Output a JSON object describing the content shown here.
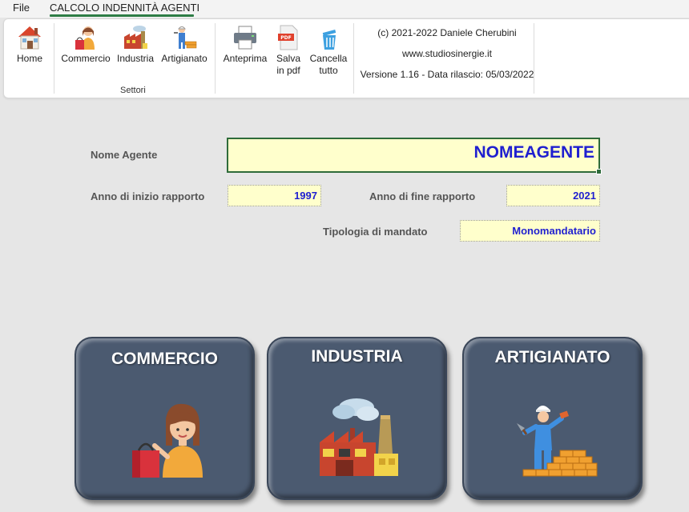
{
  "menu": {
    "file": "File",
    "active_tab": "CALCOLO INDENNITÀ AGENTI"
  },
  "ribbon": {
    "home": "Home",
    "commercio": "Commercio",
    "industria": "Industria",
    "artigianato": "Artigianato",
    "group_label": "Settori",
    "anteprima": "Anteprima",
    "salva_line1": "Salva",
    "salva_line2": "in pdf",
    "cancella_line1": "Cancella",
    "cancella_line2": "tutto",
    "copyright": "(c) 2021-2022 Daniele Cherubini",
    "website": "www.studiosinergie.it",
    "version": "Versione 1.16 - Data rilascio: 05/03/2022"
  },
  "form": {
    "nome_label": "Nome Agente",
    "nome_value": "NOMEAGENTE",
    "anno_inizio_label": "Anno di inizio rapporto",
    "anno_inizio_value": "1997",
    "anno_fine_label": "Anno di fine rapporto",
    "anno_fine_value": "2021",
    "tipologia_label": "Tipologia di mandato",
    "tipologia_value": "Monomandatario"
  },
  "cards": {
    "commercio": "COMMERCIO",
    "industria": "INDUSTRIA",
    "artigianato": "ARTIGIANATO"
  },
  "colors": {
    "accent": "#2e7d46",
    "field_bg": "#ffffcc",
    "field_text": "#1f1fd0",
    "card_bg": "#4b5a70"
  }
}
